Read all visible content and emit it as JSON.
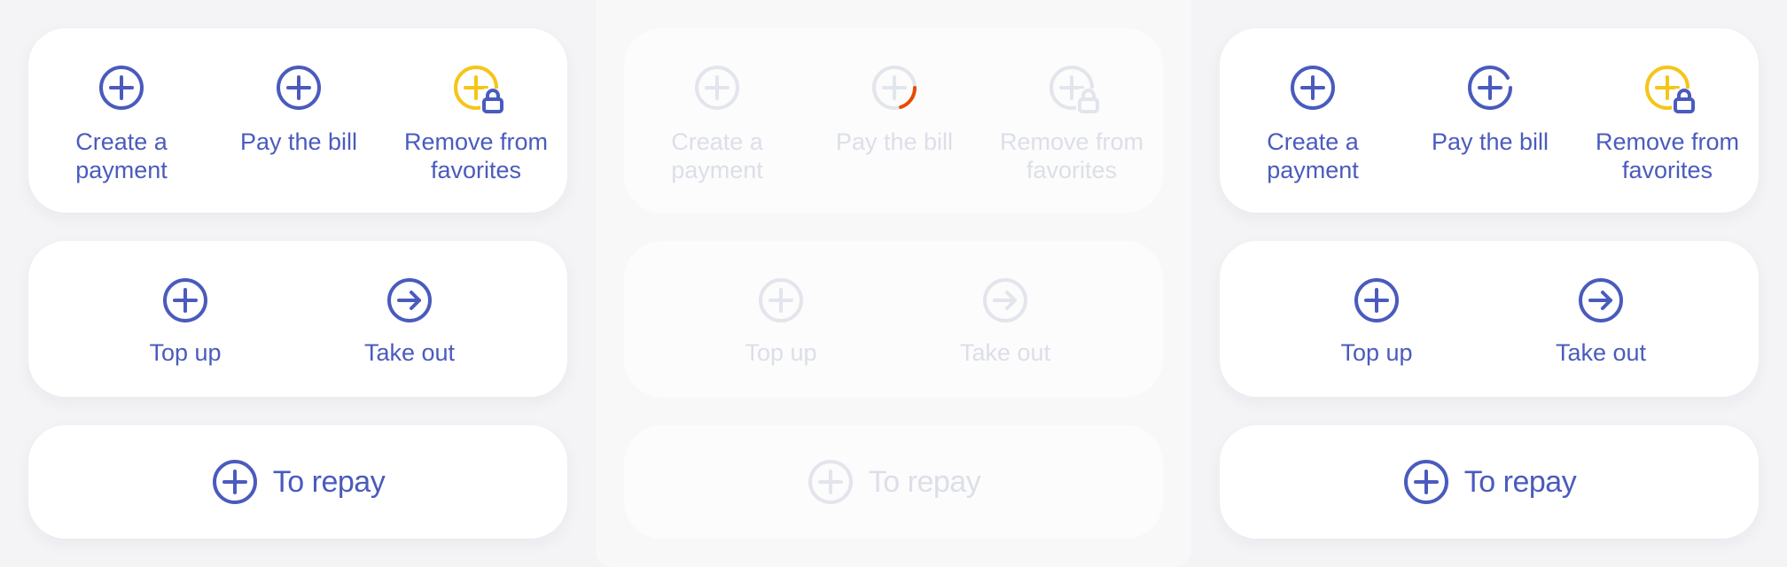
{
  "colors": {
    "accent": "#4a5bbd",
    "warning": "#f5c518",
    "disabled": "#e3e5ec",
    "spinner": "#e84a00"
  },
  "states": [
    {
      "state": "default",
      "top_panel": {
        "create_payment": "Create a payment",
        "pay_bill": "Pay the bill",
        "remove_favorites": "Remove from favorites"
      },
      "middle_panel": {
        "top_up": "Top up",
        "take_out": "Take out"
      },
      "bottom_panel": {
        "to_repay": "To repay"
      }
    },
    {
      "state": "loading",
      "top_panel": {
        "create_payment": "Create a payment",
        "pay_bill": "Pay the bill",
        "remove_favorites": "Remove from favorites"
      },
      "middle_panel": {
        "top_up": "Top up",
        "take_out": "Take out"
      },
      "bottom_panel": {
        "to_repay": "To repay"
      }
    },
    {
      "state": "pressed",
      "top_panel": {
        "create_payment": "Create a payment",
        "pay_bill": "Pay the bill",
        "remove_favorites": "Remove from favorites"
      },
      "middle_panel": {
        "top_up": "Top up",
        "take_out": "Take out"
      },
      "bottom_panel": {
        "to_repay": "To repay"
      }
    }
  ]
}
